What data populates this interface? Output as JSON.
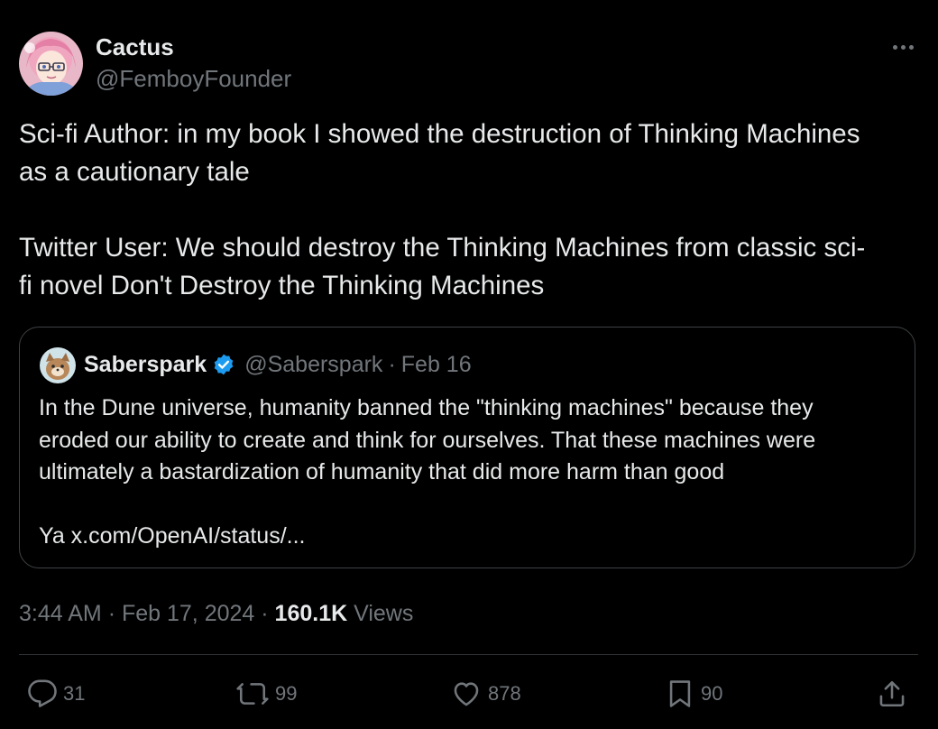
{
  "colors": {
    "background": "#000000",
    "text_primary": "#e7e9ea",
    "text_secondary": "#71767b",
    "border": "#3e4144",
    "verified_badge": "#1d9bf0"
  },
  "author": {
    "display_name": "Cactus",
    "handle": "@FemboyFounder",
    "avatar_icon": "anime-avatar"
  },
  "tweet": {
    "text": "Sci-fi Author: in my book I showed the destruction of Thinking Machines\nas a cautionary tale\n\nTwitter User: We should destroy the Thinking Machines from classic sci-\nfi novel Don't Destroy the Thinking Machines"
  },
  "quote": {
    "display_name": "Saberspark",
    "verified": true,
    "handle": "@Saberspark",
    "separator": "·",
    "date": "Feb 16",
    "text": "In the Dune universe, humanity banned the \"thinking machines\" because they\neroded our ability to create and think for ourselves. That these machines were\nultimately a bastardization of humanity that did more harm than good\n\nYa x.com/OpenAI/status/..."
  },
  "meta": {
    "time": "3:44 AM",
    "separator": "·",
    "date": "Feb 17, 2024",
    "views_count": "160.1K",
    "views_label": "Views"
  },
  "actions": {
    "replies": "31",
    "reposts": "99",
    "likes": "878",
    "bookmarks": "90"
  },
  "icons": [
    "more-icon",
    "verified-icon",
    "reply-icon",
    "repost-icon",
    "like-icon",
    "bookmark-icon",
    "share-icon"
  ]
}
